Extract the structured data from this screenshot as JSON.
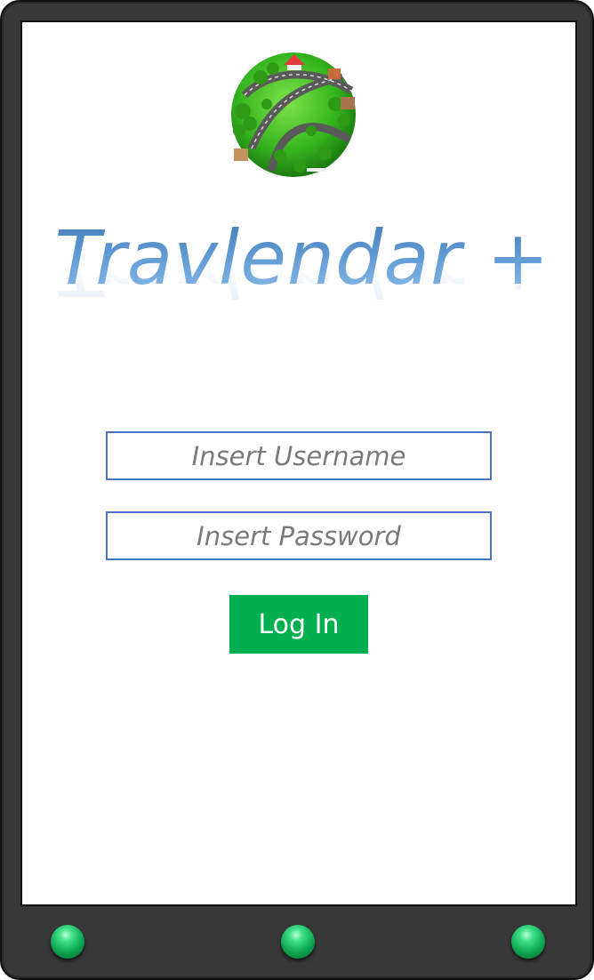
{
  "app": {
    "title": "Travlendar +"
  },
  "login_form": {
    "username_placeholder": "Insert Username",
    "password_placeholder": "Insert Password",
    "login_label": "Log In"
  },
  "colors": {
    "accent_green": "#00b050",
    "field_border": "#4a72c4",
    "title_blue": "#5b93cf"
  },
  "icons": {
    "logo": "globe-city-logo-icon",
    "nav_buttons": [
      "green-left-button-icon",
      "green-home-button-icon",
      "green-right-button-icon"
    ]
  }
}
